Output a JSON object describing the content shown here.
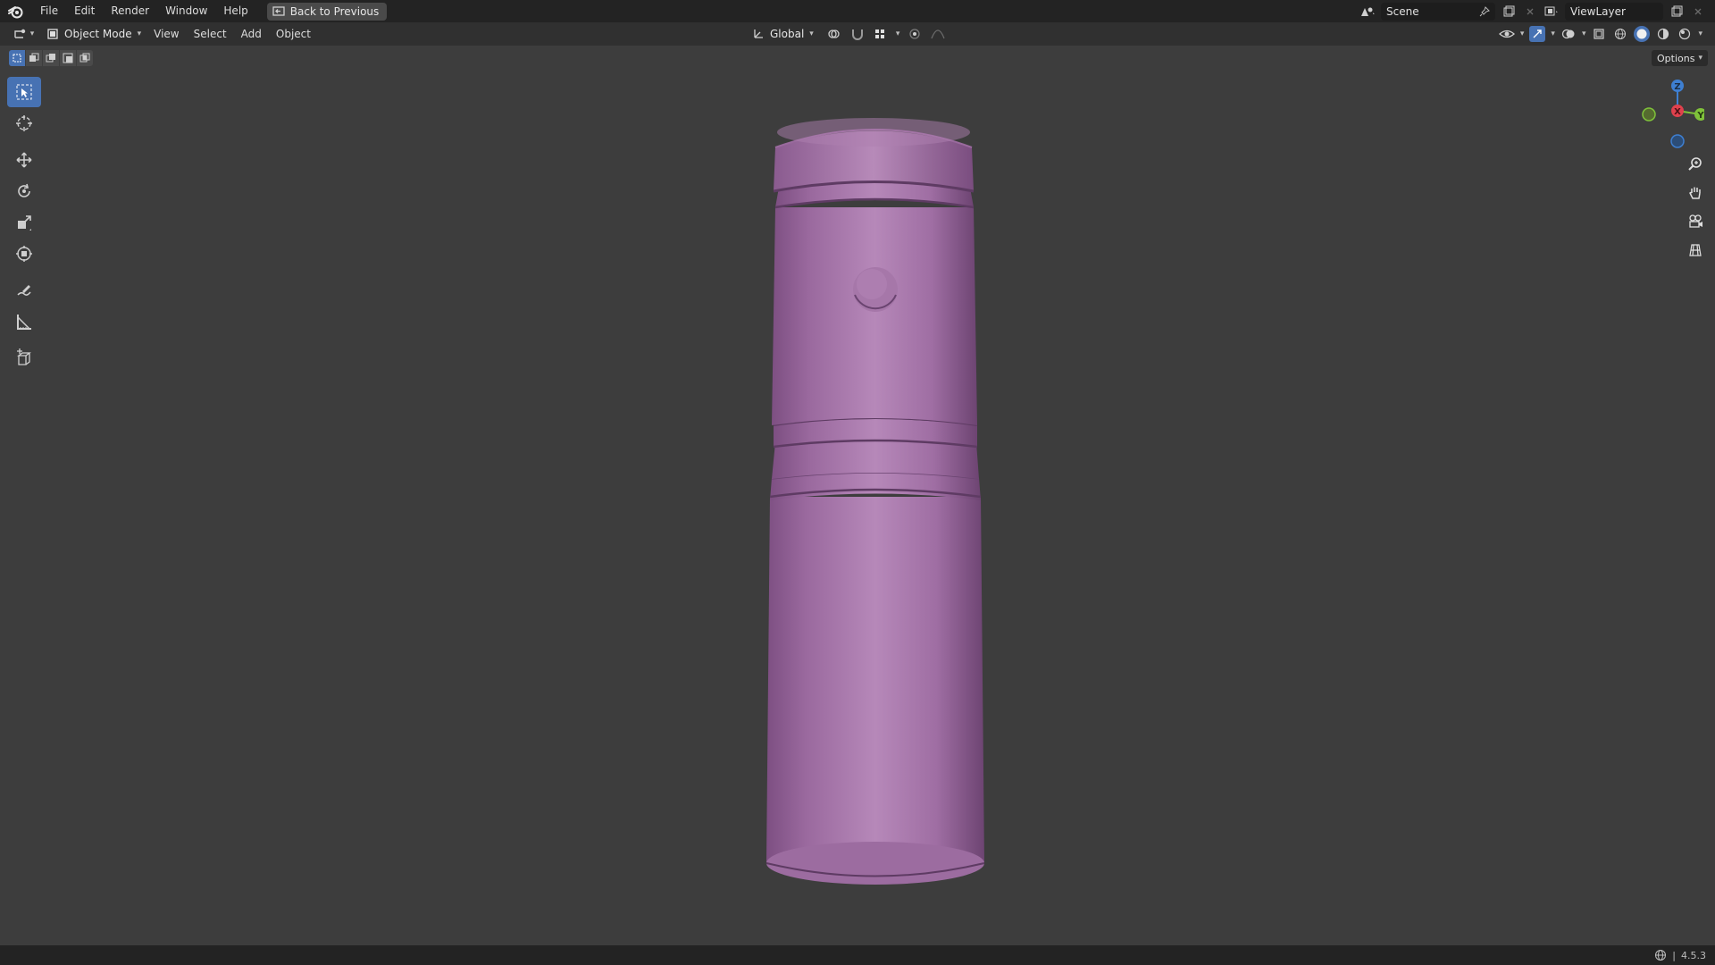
{
  "topbar": {
    "menus": [
      "File",
      "Edit",
      "Render",
      "Window",
      "Help"
    ],
    "back_button": "Back to Previous",
    "scene_label": "Scene",
    "viewlayer_label": "ViewLayer"
  },
  "header": {
    "mode": "Object Mode",
    "menus": [
      "View",
      "Select",
      "Add",
      "Object"
    ],
    "transform_orientation": "Global"
  },
  "viewport": {
    "options_label": "Options",
    "gizmo": {
      "z": "Z",
      "y": "Y",
      "x": "X"
    }
  },
  "toolbar": {
    "tools": [
      "select-box",
      "cursor",
      "move",
      "rotate",
      "scale",
      "transform",
      "annotate",
      "measure",
      "add-cube"
    ],
    "active_tool": "select-box"
  },
  "statusbar": {
    "version": "4.5.3"
  },
  "colors": {
    "object": "#b07fb4",
    "active": "#4772b3",
    "axis_x": "#e0414d",
    "axis_y": "#7fc23a",
    "axis_z": "#3e7fd1"
  }
}
